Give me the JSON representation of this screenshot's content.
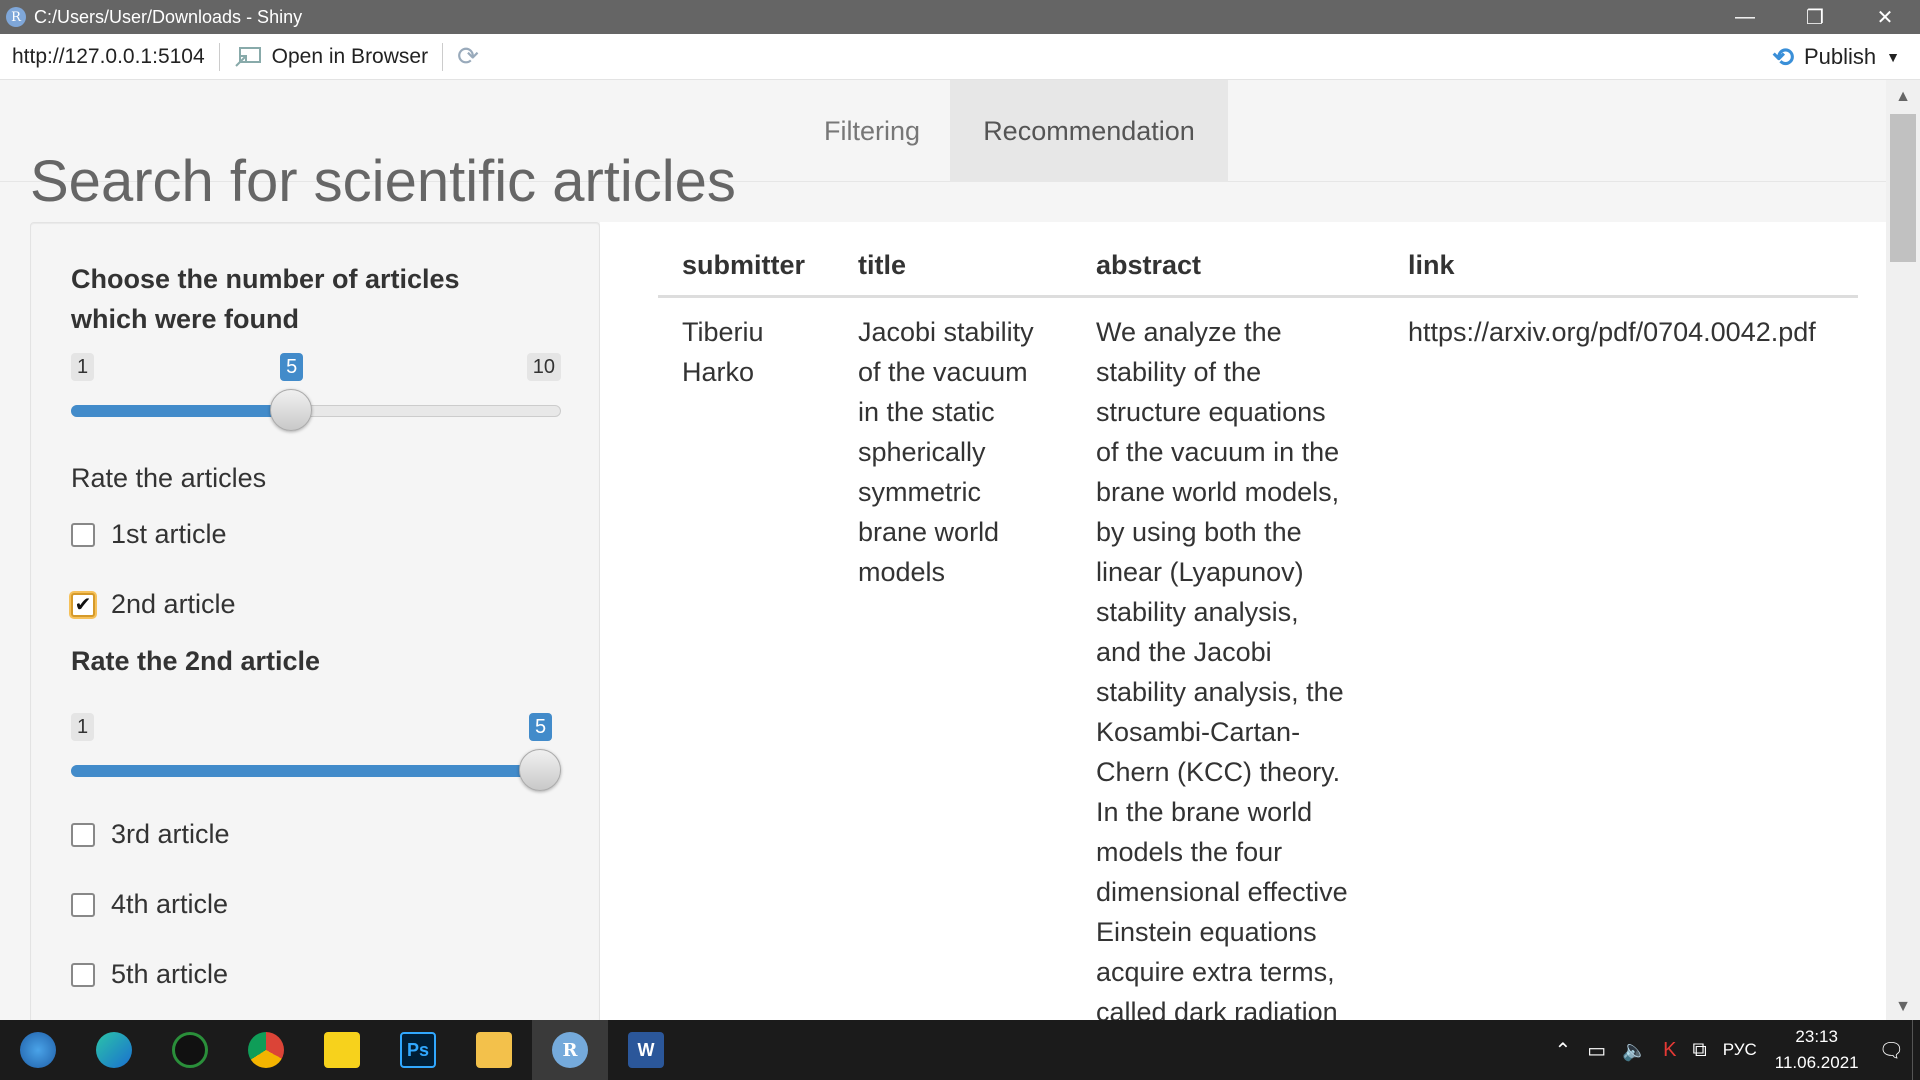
{
  "window": {
    "title": "C:/Users/User/Downloads - Shiny",
    "icon_letter": "R",
    "minimize_icon": "—",
    "restore_icon": "❐",
    "close_icon": "✕"
  },
  "toolbar": {
    "url": "http://127.0.0.1:5104",
    "open_browser_label": "Open in Browser",
    "publish_label": "Publish"
  },
  "nav": {
    "tabs": [
      {
        "label": "Filtering",
        "active": false
      },
      {
        "label": "Recommendation",
        "active": true
      }
    ]
  },
  "page": {
    "title": "Search for scientific articles"
  },
  "sidebar": {
    "count_label_line1": "Choose the number of articles",
    "count_label_line2": "which were found",
    "count_slider": {
      "min": "1",
      "max": "10",
      "value": "5",
      "level": 5
    },
    "rate_heading": "Rate the articles",
    "articles": [
      {
        "label": "1st article",
        "checked": false
      },
      {
        "label": "2nd article",
        "checked": true
      },
      {
        "label": "3rd article",
        "checked": false
      },
      {
        "label": "4th article",
        "checked": false
      },
      {
        "label": "5th article",
        "checked": false
      }
    ],
    "rate2_label": "Rate the 2nd article",
    "rate2_slider": {
      "min": "1",
      "max": "5",
      "value": "5",
      "level": 5
    }
  },
  "table": {
    "headers": [
      "submitter",
      "title",
      "abstract",
      "link"
    ],
    "rows": [
      {
        "submitter": [
          "Tiberiu",
          "Harko"
        ],
        "title": [
          "Jacobi stability",
          "of the vacuum",
          "in the static",
          "spherically",
          "symmetric",
          "brane world",
          "models"
        ],
        "abstract": [
          "We analyze the",
          "stability of the",
          "structure equations",
          "of the vacuum in the",
          "brane world models,",
          "by using both the",
          "linear (Lyapunov)",
          "stability analysis,",
          "and the Jacobi",
          "stability analysis, the",
          "Kosambi-Cartan-",
          "Chern (KCC) theory.",
          "In the brane world",
          "models the four",
          "dimensional effective",
          "Einstein equations",
          "acquire extra terms,",
          "called dark radiation"
        ],
        "link": "https://arxiv.org/pdf/0704.0042.pdf"
      }
    ]
  },
  "taskbar": {
    "apps": [
      "start",
      "edge",
      "app-green",
      "chrome",
      "sticky-notes",
      "photoshop",
      "explorer",
      "rstudio",
      "word"
    ],
    "lang": "РУС",
    "time": "23:13",
    "date": "11.06.2021"
  }
}
